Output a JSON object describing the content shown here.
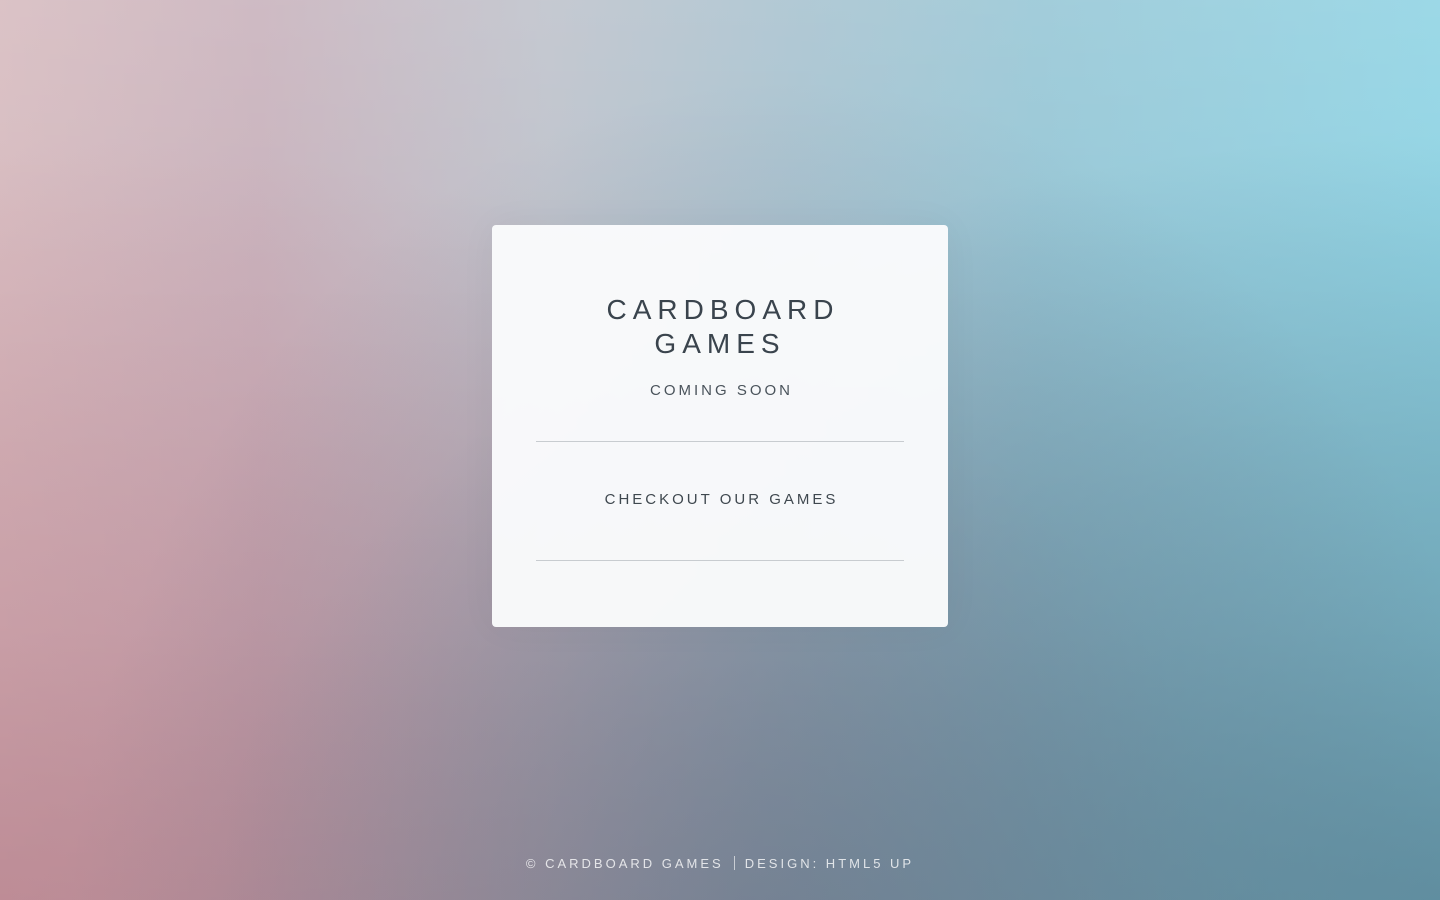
{
  "header": {
    "title": "CARDBOARD GAMES",
    "subtitle": "COMING SOON"
  },
  "main": {
    "cta_label": "CHECKOUT OUR GAMES"
  },
  "footer": {
    "copyright": "© CARDBOARD GAMES",
    "design_credit": "DESIGN: HTML5 UP"
  },
  "colors": {
    "title_text": "#3a444d",
    "card_background": "#fafbfc",
    "divider": "#c8ccd0",
    "footer_text": "#ffffff"
  }
}
